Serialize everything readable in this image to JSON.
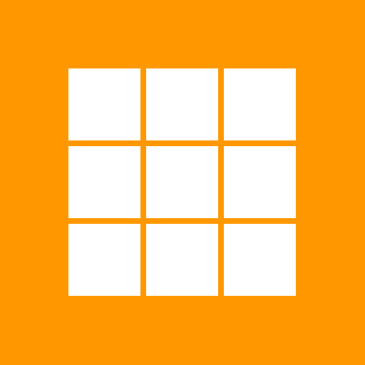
{
  "icon": {
    "name": "grid-icon",
    "background_color": "#FF9800",
    "tile_color": "#FFFFFF",
    "rows": 3,
    "columns": 3
  }
}
